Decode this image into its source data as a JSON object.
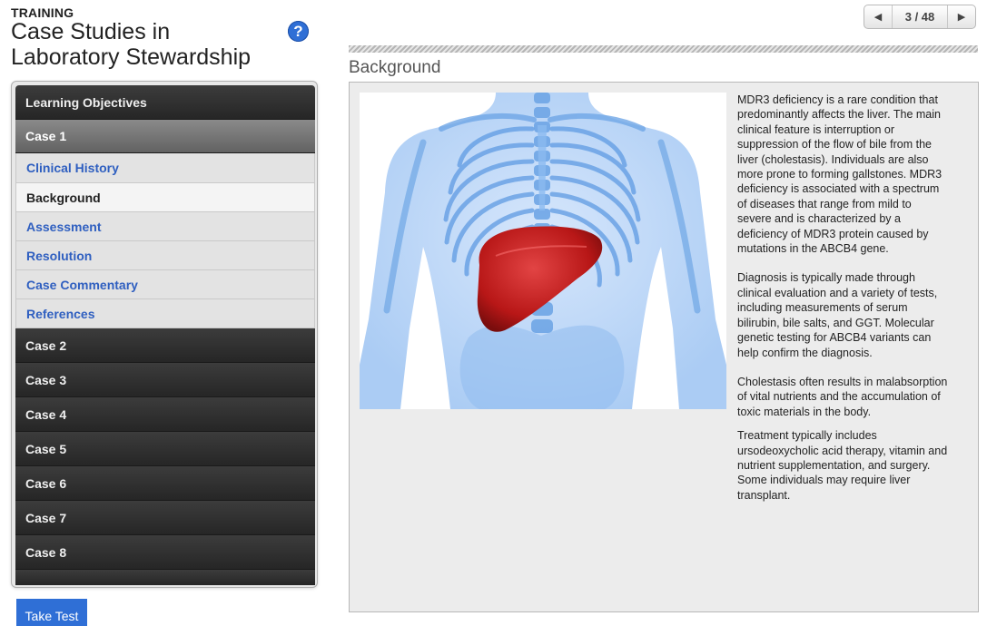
{
  "header": {
    "kicker": "TRAINING",
    "title": "Case Studies in Laboratory Stewardship",
    "help_icon": "?"
  },
  "pager": {
    "prev_icon": "◀",
    "count": "3 / 48",
    "next_icon": "▶"
  },
  "sidebar": {
    "learning_objectives": "Learning Objectives",
    "case1": "Case 1",
    "case1_items": [
      "Clinical History",
      "Background",
      "Assessment",
      "Resolution",
      "Case Commentary",
      "References"
    ],
    "active_item": "Background",
    "cases": [
      "Case 2",
      "Case 3",
      "Case 4",
      "Case 5",
      "Case 6",
      "Case 7",
      "Case 8"
    ]
  },
  "take_test": "Take Test",
  "main": {
    "section_title": "Background",
    "paragraphs": [
      "MDR3 deficiency is a rare condition that predominantly affects the liver. The main clinical feature is interruption or suppression of the flow of bile from the liver (cholestasis).  Individuals are also more prone to forming gallstones. MDR3 deficiency is associated with a spectrum of diseases that range from mild to severe and is characterized by a deficiency of MDR3 protein caused by mutations in the ABCB4 gene.",
      "Diagnosis is typically made through clinical evaluation and a variety of tests, including measurements of serum bilirubin, bile salts, and GGT. Molecular genetic testing for ABCB4 variants can help confirm the diagnosis.",
      "Cholestasis often results in malabsorption of vital nutrients and the accumulation of toxic materials in the body.",
      "Treatment typically includes ursodeoxycholic acid therapy, vitamin and nutrient supplementation, and surgery.  Some individuals may require liver transplant."
    ]
  },
  "colors": {
    "accent": "#2f6fd6",
    "link": "#2f5fc0",
    "menu_dark": "#2e2e2e",
    "liver": "#c91f1f",
    "skeleton": "#7fb2ec"
  }
}
